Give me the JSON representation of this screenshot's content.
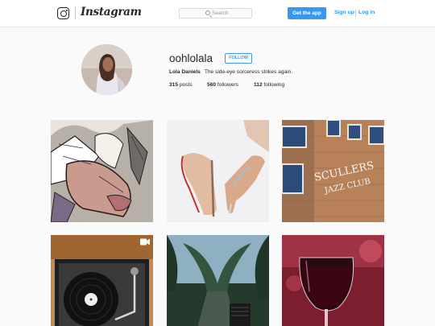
{
  "header": {
    "wordmark": "Instagram",
    "search_placeholder": "Search",
    "get_app_label": "Get the app",
    "signup_label": "Sign up",
    "login_label": "Log in"
  },
  "profile": {
    "username": "oohlolala",
    "follow_label": "FOLLOW",
    "full_name": "Lola Daniels",
    "bio": "The side-eye sorceress strikes again.",
    "stats": {
      "posts_count": "315",
      "posts_label": "posts",
      "followers_count": "560",
      "followers_label": "followers",
      "following_count": "112",
      "following_label": "following"
    }
  },
  "posts": [
    {
      "subject": "illustration of a reclining figure in fur"
    },
    {
      "subject": "nude patent high heels with red soles"
    },
    {
      "subject": "Scullers Jazz Club brick building sign",
      "sign_line1": "SCULLERS",
      "sign_line2": "JAZZ CLUB"
    },
    {
      "subject": "vinyl record turntable",
      "is_video": true
    },
    {
      "subject": "tree-lined garden path"
    },
    {
      "subject": "glass of red wine"
    }
  ],
  "colors": {
    "accent": "#3897f0",
    "text": "#262626",
    "background": "#fafafa"
  }
}
